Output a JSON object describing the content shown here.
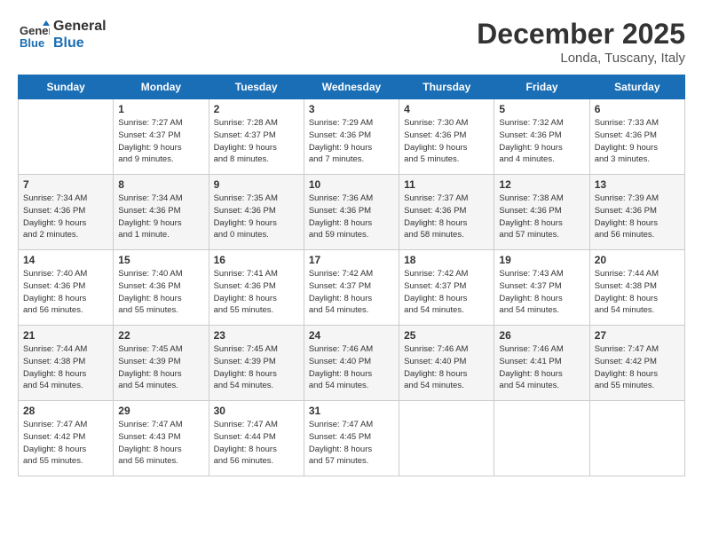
{
  "header": {
    "logo_line1": "General",
    "logo_line2": "Blue",
    "month": "December 2025",
    "location": "Londa, Tuscany, Italy"
  },
  "weekdays": [
    "Sunday",
    "Monday",
    "Tuesday",
    "Wednesday",
    "Thursday",
    "Friday",
    "Saturday"
  ],
  "weeks": [
    [
      {
        "day": "",
        "text": ""
      },
      {
        "day": "1",
        "text": "Sunrise: 7:27 AM\nSunset: 4:37 PM\nDaylight: 9 hours\nand 9 minutes."
      },
      {
        "day": "2",
        "text": "Sunrise: 7:28 AM\nSunset: 4:37 PM\nDaylight: 9 hours\nand 8 minutes."
      },
      {
        "day": "3",
        "text": "Sunrise: 7:29 AM\nSunset: 4:36 PM\nDaylight: 9 hours\nand 7 minutes."
      },
      {
        "day": "4",
        "text": "Sunrise: 7:30 AM\nSunset: 4:36 PM\nDaylight: 9 hours\nand 5 minutes."
      },
      {
        "day": "5",
        "text": "Sunrise: 7:32 AM\nSunset: 4:36 PM\nDaylight: 9 hours\nand 4 minutes."
      },
      {
        "day": "6",
        "text": "Sunrise: 7:33 AM\nSunset: 4:36 PM\nDaylight: 9 hours\nand 3 minutes."
      }
    ],
    [
      {
        "day": "7",
        "text": "Sunrise: 7:34 AM\nSunset: 4:36 PM\nDaylight: 9 hours\nand 2 minutes."
      },
      {
        "day": "8",
        "text": "Sunrise: 7:34 AM\nSunset: 4:36 PM\nDaylight: 9 hours\nand 1 minute."
      },
      {
        "day": "9",
        "text": "Sunrise: 7:35 AM\nSunset: 4:36 PM\nDaylight: 9 hours\nand 0 minutes."
      },
      {
        "day": "10",
        "text": "Sunrise: 7:36 AM\nSunset: 4:36 PM\nDaylight: 8 hours\nand 59 minutes."
      },
      {
        "day": "11",
        "text": "Sunrise: 7:37 AM\nSunset: 4:36 PM\nDaylight: 8 hours\nand 58 minutes."
      },
      {
        "day": "12",
        "text": "Sunrise: 7:38 AM\nSunset: 4:36 PM\nDaylight: 8 hours\nand 57 minutes."
      },
      {
        "day": "13",
        "text": "Sunrise: 7:39 AM\nSunset: 4:36 PM\nDaylight: 8 hours\nand 56 minutes."
      }
    ],
    [
      {
        "day": "14",
        "text": "Sunrise: 7:40 AM\nSunset: 4:36 PM\nDaylight: 8 hours\nand 56 minutes."
      },
      {
        "day": "15",
        "text": "Sunrise: 7:40 AM\nSunset: 4:36 PM\nDaylight: 8 hours\nand 55 minutes."
      },
      {
        "day": "16",
        "text": "Sunrise: 7:41 AM\nSunset: 4:36 PM\nDaylight: 8 hours\nand 55 minutes."
      },
      {
        "day": "17",
        "text": "Sunrise: 7:42 AM\nSunset: 4:37 PM\nDaylight: 8 hours\nand 54 minutes."
      },
      {
        "day": "18",
        "text": "Sunrise: 7:42 AM\nSunset: 4:37 PM\nDaylight: 8 hours\nand 54 minutes."
      },
      {
        "day": "19",
        "text": "Sunrise: 7:43 AM\nSunset: 4:37 PM\nDaylight: 8 hours\nand 54 minutes."
      },
      {
        "day": "20",
        "text": "Sunrise: 7:44 AM\nSunset: 4:38 PM\nDaylight: 8 hours\nand 54 minutes."
      }
    ],
    [
      {
        "day": "21",
        "text": "Sunrise: 7:44 AM\nSunset: 4:38 PM\nDaylight: 8 hours\nand 54 minutes."
      },
      {
        "day": "22",
        "text": "Sunrise: 7:45 AM\nSunset: 4:39 PM\nDaylight: 8 hours\nand 54 minutes."
      },
      {
        "day": "23",
        "text": "Sunrise: 7:45 AM\nSunset: 4:39 PM\nDaylight: 8 hours\nand 54 minutes."
      },
      {
        "day": "24",
        "text": "Sunrise: 7:46 AM\nSunset: 4:40 PM\nDaylight: 8 hours\nand 54 minutes."
      },
      {
        "day": "25",
        "text": "Sunrise: 7:46 AM\nSunset: 4:40 PM\nDaylight: 8 hours\nand 54 minutes."
      },
      {
        "day": "26",
        "text": "Sunrise: 7:46 AM\nSunset: 4:41 PM\nDaylight: 8 hours\nand 54 minutes."
      },
      {
        "day": "27",
        "text": "Sunrise: 7:47 AM\nSunset: 4:42 PM\nDaylight: 8 hours\nand 55 minutes."
      }
    ],
    [
      {
        "day": "28",
        "text": "Sunrise: 7:47 AM\nSunset: 4:42 PM\nDaylight: 8 hours\nand 55 minutes."
      },
      {
        "day": "29",
        "text": "Sunrise: 7:47 AM\nSunset: 4:43 PM\nDaylight: 8 hours\nand 56 minutes."
      },
      {
        "day": "30",
        "text": "Sunrise: 7:47 AM\nSunset: 4:44 PM\nDaylight: 8 hours\nand 56 minutes."
      },
      {
        "day": "31",
        "text": "Sunrise: 7:47 AM\nSunset: 4:45 PM\nDaylight: 8 hours\nand 57 minutes."
      },
      {
        "day": "",
        "text": ""
      },
      {
        "day": "",
        "text": ""
      },
      {
        "day": "",
        "text": ""
      }
    ]
  ]
}
